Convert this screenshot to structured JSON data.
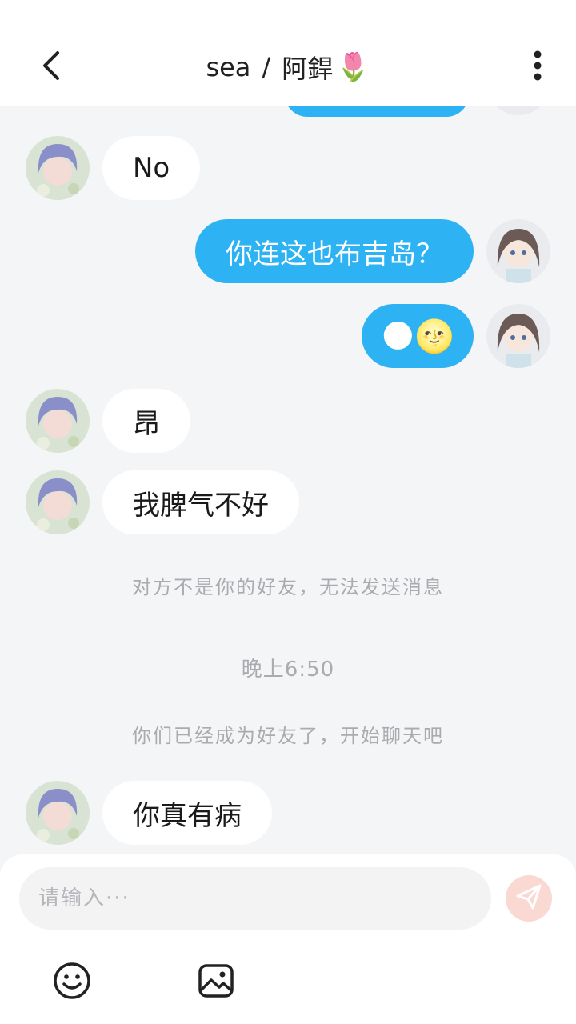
{
  "header": {
    "name_left": "sea",
    "separator": "/",
    "name_right": "阿銲",
    "name_emoji": "🌷",
    "back_icon": "chevron-left-icon",
    "more_icon": "more-vertical-icon"
  },
  "messages": [
    {
      "side": "in",
      "text": "No"
    },
    {
      "side": "out",
      "text": "你连这也布吉岛？"
    },
    {
      "side": "out",
      "text": "🌑🌝"
    },
    {
      "side": "in",
      "text": "昂"
    },
    {
      "side": "in",
      "text": "我脾气不好"
    },
    {
      "side": "in",
      "text": "你真有病"
    }
  ],
  "system": {
    "not_friend": "对方不是你的好友，无法发送消息",
    "time": "晚上6:50",
    "now_friends": "你们已经成为好友了，开始聊天吧"
  },
  "composer": {
    "placeholder": "请输入···",
    "send_icon": "send-icon",
    "emoji_icon": "smiley-icon",
    "image_icon": "image-icon"
  },
  "colors": {
    "accent": "#2db2f4",
    "background": "#f4f5f7",
    "send_disabled": "#fbd9d3"
  }
}
